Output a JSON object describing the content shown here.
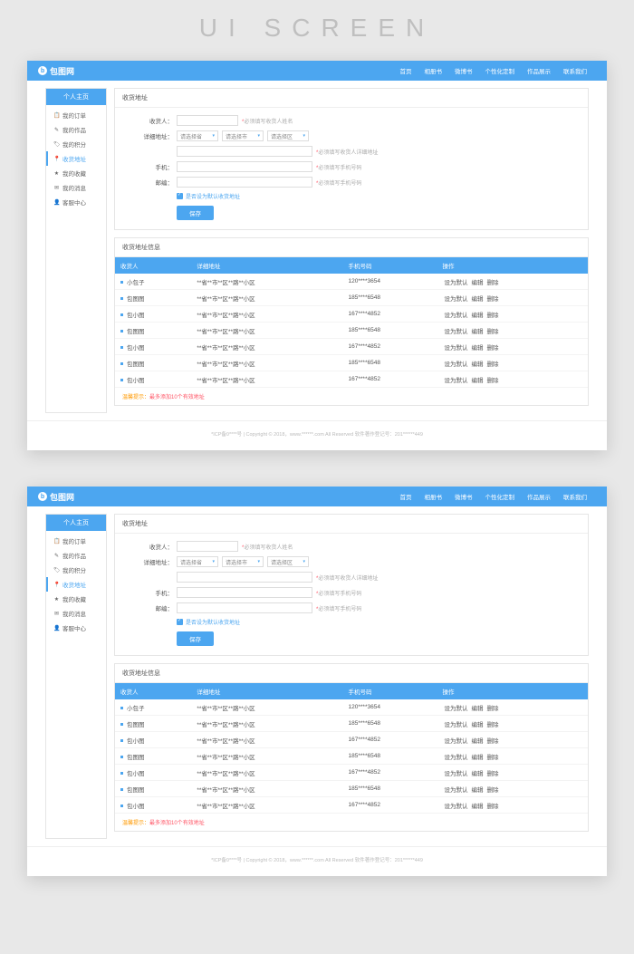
{
  "bg_title": "UI SCREEN",
  "brand": "包图网",
  "nav": [
    "首页",
    "相册书",
    "微博书",
    "个性化定制",
    "作品展示",
    "联系我们"
  ],
  "sidebar": {
    "title": "个人主页",
    "items": [
      {
        "icon": "📋",
        "label": "我的订单"
      },
      {
        "icon": "✎",
        "label": "我的作品"
      },
      {
        "icon": "🏷",
        "label": "我的积分"
      },
      {
        "icon": "📍",
        "label": "收货地址",
        "active": true
      },
      {
        "icon": "★",
        "label": "我的收藏"
      },
      {
        "icon": "✉",
        "label": "我的消息"
      },
      {
        "icon": "👤",
        "label": "客服中心"
      }
    ]
  },
  "panel1_title": "收货地址",
  "form": {
    "recipient_label": "收货人：",
    "recipient_hint": "*必须填写收货人姓名",
    "addr_label": "详细地址：",
    "sel_province": "请选择省",
    "sel_city": "请选择市",
    "sel_district": "请选择区",
    "addr_hint": "*必须填写收货人详细地址",
    "phone_label": "手机：",
    "phone_hint": "*必须填写手机号码",
    "zip_label": "邮编：",
    "zip_hint": "*必须填写手机号码",
    "default_label": "是否设为默认收货地址",
    "save": "保存"
  },
  "panel2_title": "收货地址信息",
  "table": {
    "headers": [
      "收货人",
      "详细地址",
      "手机号码",
      "操作"
    ],
    "rows": [
      {
        "name": "小包子",
        "addr": "**省**市**区**路**小区",
        "phone": "120****3654",
        "ops": [
          "设为默认",
          "编辑",
          "删除"
        ]
      },
      {
        "name": "包图图",
        "addr": "**省**市**区**路**小区",
        "phone": "185****6548",
        "ops": [
          "设为默认",
          "编辑",
          "删除"
        ]
      },
      {
        "name": "包小图",
        "addr": "**省**市**区**路**小区",
        "phone": "167****4852",
        "ops": [
          "设为默认",
          "编辑",
          "删除"
        ]
      },
      {
        "name": "包图图",
        "addr": "**省**市**区**路**小区",
        "phone": "185****6548",
        "ops": [
          "设为默认",
          "编辑",
          "删除"
        ]
      },
      {
        "name": "包小图",
        "addr": "**省**市**区**路**小区",
        "phone": "167****4852",
        "ops": [
          "设为默认",
          "编辑",
          "删除"
        ]
      },
      {
        "name": "包图图",
        "addr": "**省**市**区**路**小区",
        "phone": "185****6548",
        "ops": [
          "设为默认",
          "编辑",
          "删除"
        ]
      },
      {
        "name": "包小图",
        "addr": "**省**市**区**路**小区",
        "phone": "167****4852",
        "ops": [
          "设为默认",
          "编辑",
          "删除"
        ]
      }
    ],
    "warm_tip_label": "温馨提示：",
    "warm_tip": "最多添加10个有效地址"
  },
  "footer": "*ICP备0****号 | Copyright © 2018，www.******.com All Reserved 软件著作登记号：201******449"
}
